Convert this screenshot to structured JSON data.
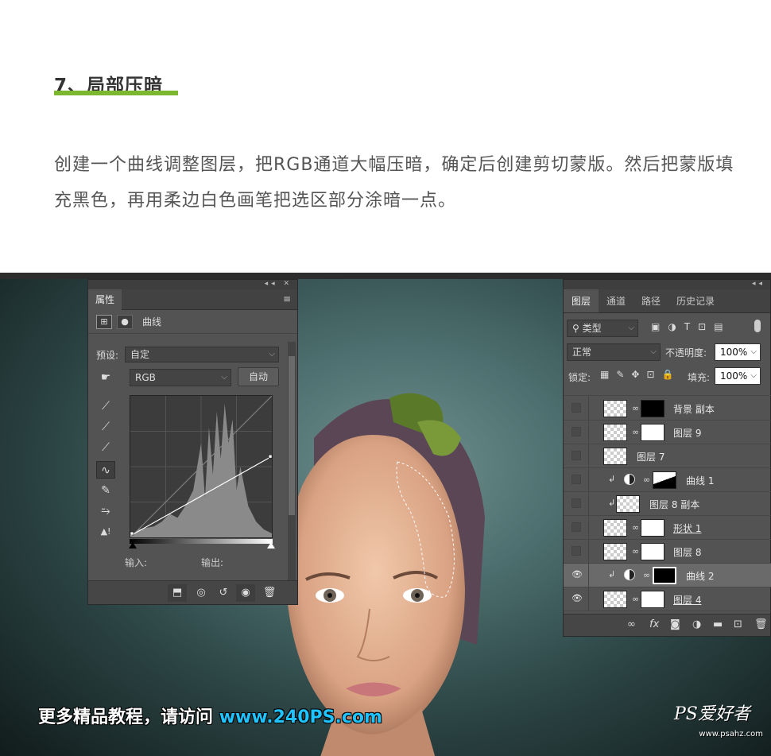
{
  "article": {
    "title": "7、局部压暗",
    "paragraph": "创建一个曲线调整图层，把RGB通道大幅压暗，确定后创建剪切蒙版。然后把蒙版填充黑色，再用柔边白色画笔把选区部分涂暗一点。"
  },
  "properties": {
    "tab": "属性",
    "adjust_label": "曲线",
    "preset_label": "预设:",
    "preset_value": "自定",
    "channel_value": "RGB",
    "auto_label": "自动",
    "input_label": "输入:",
    "output_label": "输出:"
  },
  "layers_panel": {
    "tabs": [
      "图层",
      "通道",
      "路径",
      "历史记录"
    ],
    "filter_value": "类型",
    "blend_mode": "正常",
    "opacity_label": "不透明度:",
    "opacity_value": "100%",
    "lock_label": "锁定:",
    "fill_label": "填充:",
    "fill_value": "100%",
    "layers": [
      {
        "name": "背景 副本"
      },
      {
        "name": "图层 9"
      },
      {
        "name": "图层 7"
      },
      {
        "name": "曲线 1"
      },
      {
        "name": "图层 8 副本"
      },
      {
        "name": "形状 1"
      },
      {
        "name": "图层 8"
      },
      {
        "name": "曲线 2"
      },
      {
        "name": "图层 4"
      }
    ]
  },
  "overlay": {
    "watermark_text": "更多精品教程，请访问",
    "watermark_url": "www.240PS.com",
    "logo_text": "PS爱好者",
    "logo_url": "www.psahz.com"
  },
  "icons": [
    "menu-icon",
    "search-icon",
    "link-icon",
    "eye-icon",
    "trash-icon",
    "fx-icon",
    "folder-icon",
    "new-layer-icon",
    "eyedropper-icon",
    "pencil-icon",
    "curve-icon"
  ]
}
